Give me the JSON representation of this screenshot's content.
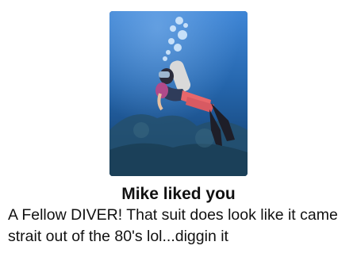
{
  "notification": {
    "title": "Mike liked you",
    "message": "A Fellow DIVER! That suit does look like it came strait out of the 80's lol...diggin it"
  },
  "photo": {
    "subject": "scuba diver underwater",
    "colors": {
      "water_top": "#3b7fd0",
      "water_bottom": "#123b66",
      "reef": "#27506b",
      "wetsuit_accent": "#e8676b"
    }
  }
}
